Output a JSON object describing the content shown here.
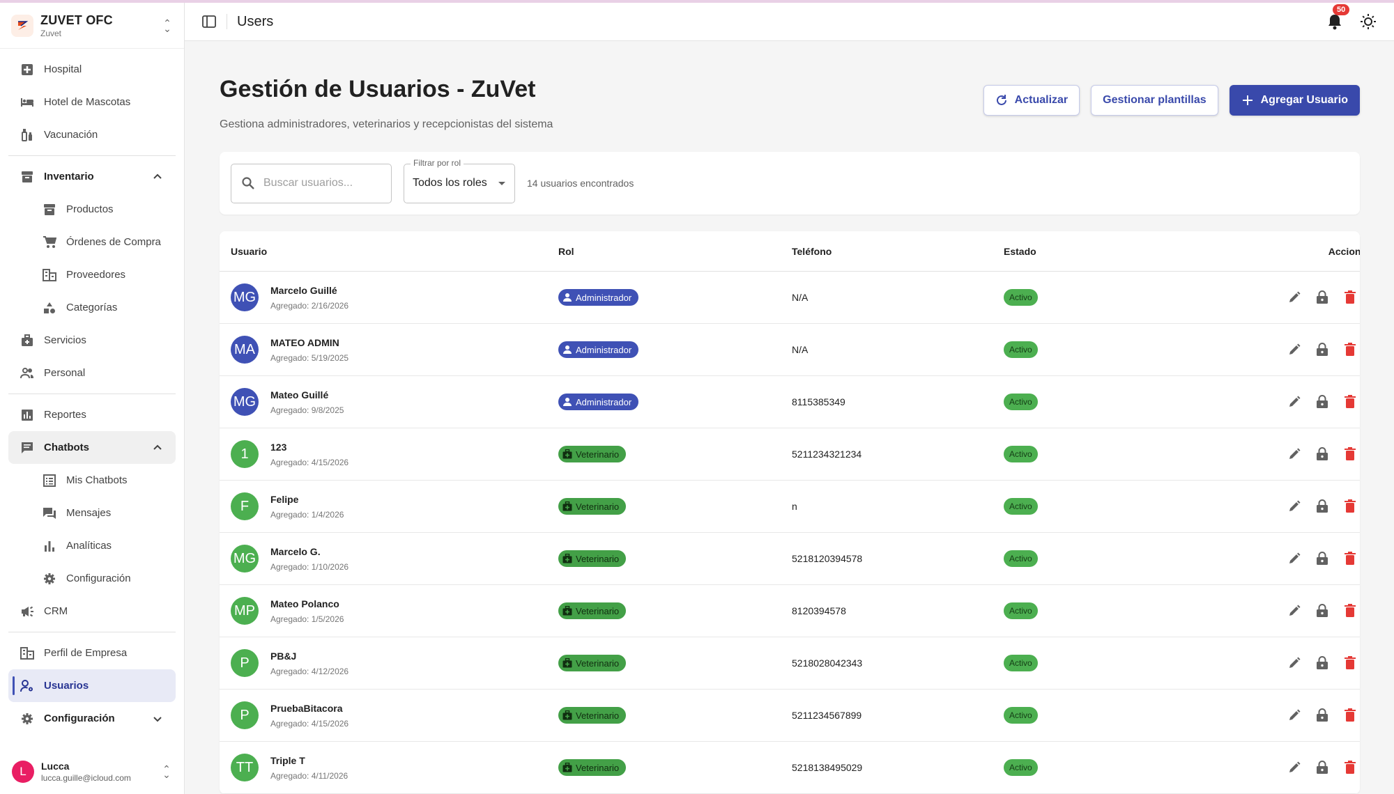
{
  "brand": {
    "title": "ZUVET OFC",
    "subtitle": "Zuvet"
  },
  "sidebar": {
    "items": [
      {
        "label": "Hospital"
      },
      {
        "label": "Hotel de Mascotas"
      },
      {
        "label": "Vacunación"
      },
      {
        "label": "Inventario"
      },
      {
        "label": "Productos"
      },
      {
        "label": "Órdenes de Compra"
      },
      {
        "label": "Proveedores"
      },
      {
        "label": "Categorías"
      },
      {
        "label": "Servicios"
      },
      {
        "label": "Personal"
      },
      {
        "label": "Reportes"
      },
      {
        "label": "Chatbots"
      },
      {
        "label": "Mis Chatbots"
      },
      {
        "label": "Mensajes"
      },
      {
        "label": "Analíticas"
      },
      {
        "label": "Configuración"
      },
      {
        "label": "CRM"
      },
      {
        "label": "Perfil de Empresa"
      },
      {
        "label": "Usuarios"
      },
      {
        "label": "Configuración"
      }
    ],
    "user": {
      "initial": "L",
      "name": "Lucca",
      "email": "lucca.guille@icloud.com"
    }
  },
  "topbar": {
    "title": "Users",
    "notifications": "50"
  },
  "page": {
    "title": "Gestión de Usuarios - ZuVet",
    "subtitle": "Gestiona administradores, veterinarios y recepcionistas del sistema",
    "buttons": {
      "refresh": "Actualizar",
      "templates": "Gestionar plantillas",
      "add": "Agregar Usuario"
    }
  },
  "filters": {
    "search_placeholder": "Buscar usuarios...",
    "role_label": "Filtrar por rol",
    "role_value": "Todos los roles",
    "count": "14 usuarios encontrados"
  },
  "table": {
    "headers": {
      "user": "Usuario",
      "role": "Rol",
      "phone": "Teléfono",
      "status": "Estado",
      "actions": "Acciones"
    },
    "rows": [
      {
        "initials": "MG",
        "name": "Marcelo Guillé",
        "added": "Agregado: 2/16/2026",
        "role": "Administrador",
        "phone": "N/A",
        "status": "Activo"
      },
      {
        "initials": "MA",
        "name": "MATEO ADMIN",
        "added": "Agregado: 5/19/2025",
        "role": "Administrador",
        "phone": "N/A",
        "status": "Activo"
      },
      {
        "initials": "MG",
        "name": "Mateo Guillé",
        "added": "Agregado: 9/8/2025",
        "role": "Administrador",
        "phone": "8115385349",
        "status": "Activo"
      },
      {
        "initials": "1",
        "name": "123",
        "added": "Agregado: 4/15/2026",
        "role": "Veterinario",
        "phone": "5211234321234",
        "status": "Activo"
      },
      {
        "initials": "F",
        "name": "Felipe",
        "added": "Agregado: 1/4/2026",
        "role": "Veterinario",
        "phone": "n",
        "status": "Activo"
      },
      {
        "initials": "MG",
        "name": "Marcelo G.",
        "added": "Agregado: 1/10/2026",
        "role": "Veterinario",
        "phone": "5218120394578",
        "status": "Activo"
      },
      {
        "initials": "MP",
        "name": "Mateo Polanco",
        "added": "Agregado: 1/5/2026",
        "role": "Veterinario",
        "phone": "8120394578",
        "status": "Activo"
      },
      {
        "initials": "P",
        "name": "PB&J",
        "added": "Agregado: 4/12/2026",
        "role": "Veterinario",
        "phone": "5218028042343",
        "status": "Activo"
      },
      {
        "initials": "P",
        "name": "PruebaBitacora",
        "added": "Agregado: 4/15/2026",
        "role": "Veterinario",
        "phone": "5211234567899",
        "status": "Activo"
      },
      {
        "initials": "TT",
        "name": "Triple T",
        "added": "Agregado: 4/11/2026",
        "role": "Veterinario",
        "phone": "5218138495029",
        "status": "Activo"
      }
    ]
  },
  "colors": {
    "primary": "#3949ab",
    "admin_avatar": "#3f51b5",
    "vet_avatar": "#4caf50",
    "status": "#4caf50",
    "delete": "#e53935"
  }
}
